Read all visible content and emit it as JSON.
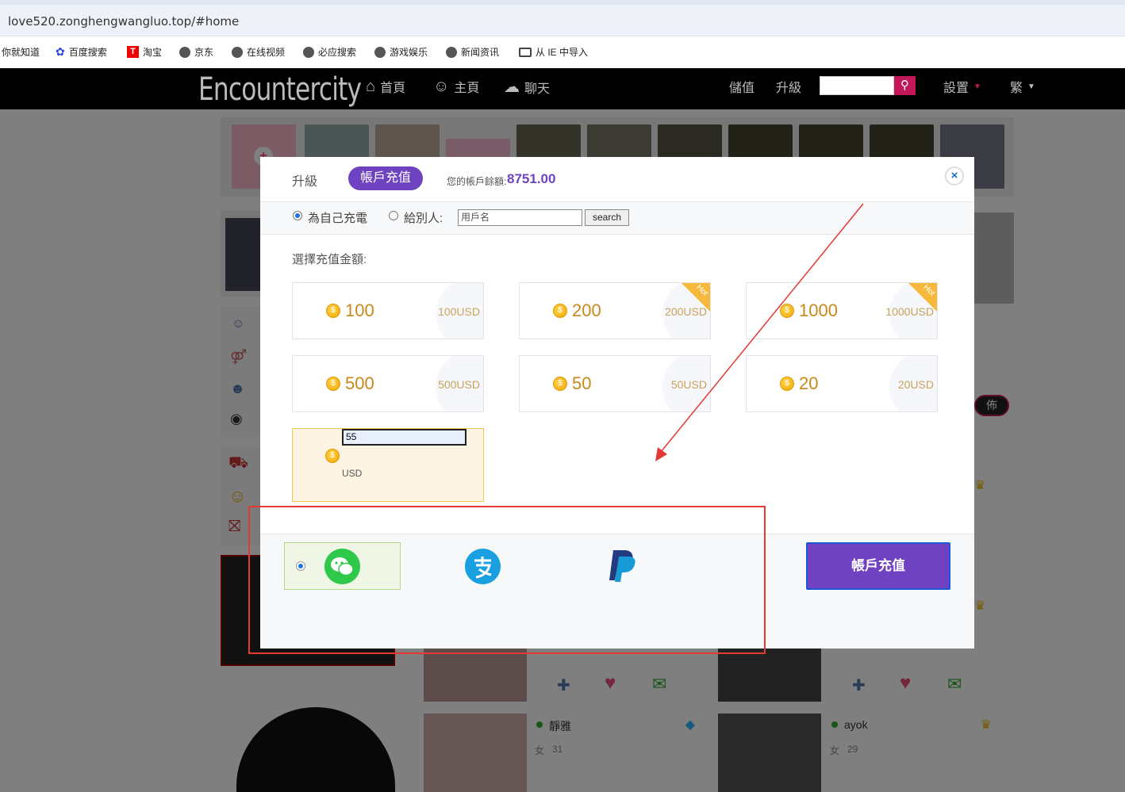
{
  "browser": {
    "url": "love520.zonghengwangluo.top/#home",
    "bookmarks": [
      "你就知道",
      "百度搜索",
      "淘宝",
      "京东",
      "在线视频",
      "必应搜索",
      "游戏娱乐",
      "新闻资讯",
      "从 IE 中导入"
    ]
  },
  "site": {
    "logo": "Encountercity",
    "nav": {
      "home": "首頁",
      "profile": "主頁",
      "chat": "聊天",
      "deposit": "儲值",
      "upgrade": "升級",
      "settings": "設置",
      "language": "繁"
    },
    "badge": "佈"
  },
  "modal": {
    "tab_upgrade": "升級",
    "tab_charge": "帳戶充值",
    "balance_label": "您的帳戶餘額:",
    "balance_value": "8751.00",
    "close": "×",
    "recipient": {
      "self": "為自己充電",
      "other": "給別人:",
      "username_placeholder": "用戶名",
      "search_label": "search",
      "selected": "self"
    },
    "amount_label": "選擇充值金額:",
    "amounts": [
      {
        "coins": "100",
        "usd": "100USD",
        "hot": false
      },
      {
        "coins": "200",
        "usd": "200USD",
        "hot": true
      },
      {
        "coins": "1000",
        "usd": "1000USD",
        "hot": true
      },
      {
        "coins": "500",
        "usd": "500USD",
        "hot": false
      },
      {
        "coins": "50",
        "usd": "50USD",
        "hot": false
      },
      {
        "coins": "20",
        "usd": "20USD",
        "hot": false
      }
    ],
    "hot_label": "Hot",
    "coin_symbol": "$",
    "custom": {
      "value": "55",
      "unit": "USD"
    },
    "payment_methods": [
      "wechat-pay",
      "alipay",
      "paypal"
    ],
    "selected_payment": "wechat-pay",
    "submit_label": "帳戶充值"
  },
  "background_cards": [
    {
      "name": "靜雅",
      "gender": "女",
      "age": "31"
    },
    {
      "name": "ayok",
      "gender": "女",
      "age": "29"
    }
  ],
  "colors": {
    "accent": "#6f42c1",
    "annotation": "#e53935",
    "coin": "#f0a500"
  }
}
